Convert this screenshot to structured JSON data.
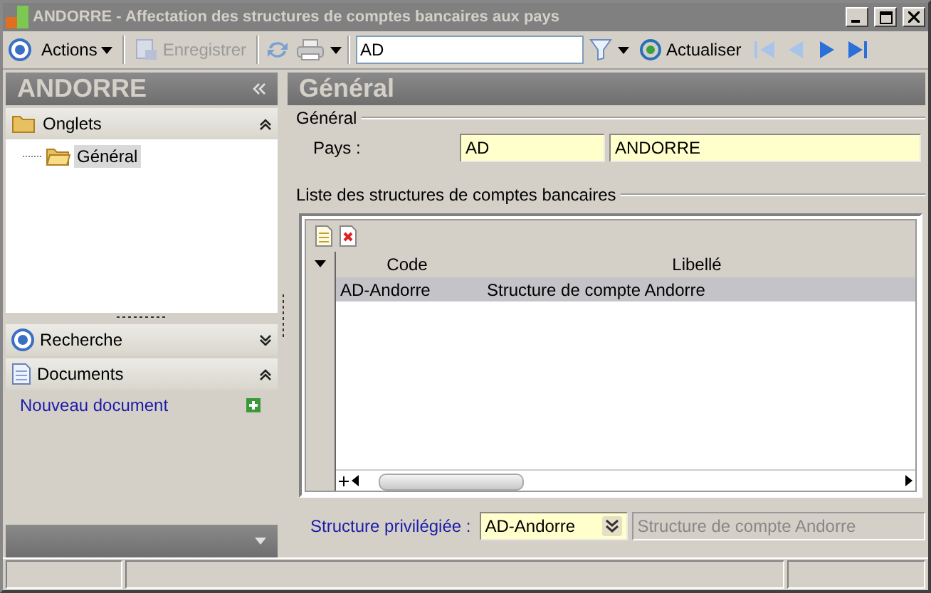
{
  "window": {
    "title": "ANDORRE -  Affectation des structures de comptes bancaires aux pays"
  },
  "toolbar": {
    "actions": "Actions",
    "save": {
      "label": "Enregistrer",
      "disabled": true
    },
    "search_value": "AD",
    "refresh": "Actualiser"
  },
  "left_panel": {
    "title": "ANDORRE",
    "sections": [
      {
        "kind": "tree",
        "title": "Onglets",
        "expanded": true,
        "items": [
          {
            "label": "Général",
            "selected": true
          }
        ]
      },
      {
        "kind": "search",
        "title": "Recherche",
        "expanded": false
      },
      {
        "kind": "documents",
        "title": "Documents",
        "expanded": true,
        "links": [
          "Nouveau document"
        ]
      }
    ]
  },
  "main": {
    "title": "Général",
    "group": "Général",
    "country": {
      "label": "Pays :",
      "code": "AD",
      "name": "ANDORRE"
    },
    "list": {
      "title": "Liste des structures de comptes bancaires",
      "columns": [
        "Code",
        "Libellé"
      ],
      "rows": [
        {
          "cells": [
            "AD-Andorre",
            "Structure de compte Andorre"
          ],
          "selected": true
        }
      ]
    },
    "preferred": {
      "label": "Structure privilégiée :",
      "value": "AD-Andorre",
      "description": "Structure de compte Andorre"
    }
  }
}
